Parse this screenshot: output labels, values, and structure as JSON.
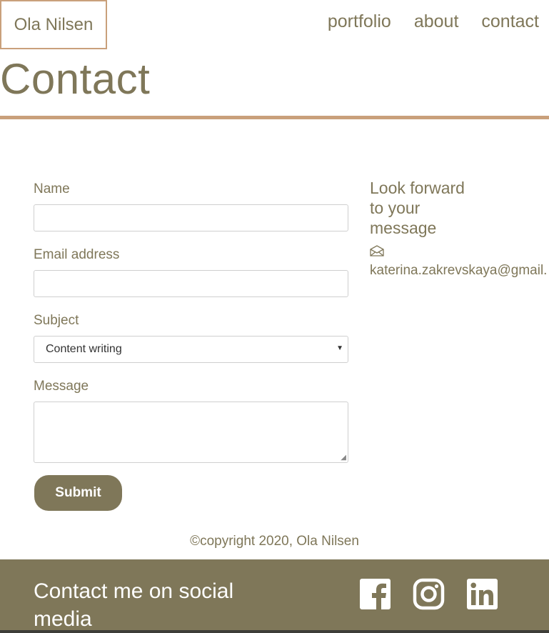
{
  "header": {
    "logo": "Ola Nilsen",
    "nav": [
      "portfolio",
      "about",
      "contact"
    ]
  },
  "page": {
    "title": "Contact"
  },
  "form": {
    "name_label": "Name",
    "name_value": "",
    "email_label": "Email address",
    "email_value": "",
    "subject_label": "Subject",
    "subject_selected": "Content writing",
    "message_label": "Message",
    "message_value": "",
    "submit_label": "Submit"
  },
  "aside": {
    "heading": "Look forward to your message",
    "email": "katerina.zakrevskaya@gmail."
  },
  "copyright": "©copyright 2020, Ola Nilsen",
  "footer": {
    "heading": "Contact me on social media",
    "social": [
      "facebook-icon",
      "instagram-icon",
      "linkedin-icon"
    ]
  },
  "colors": {
    "text": "#7f7759",
    "accent": "#c9a07b",
    "footer_bg": "#7f7759",
    "button_bg": "#7f7759"
  }
}
